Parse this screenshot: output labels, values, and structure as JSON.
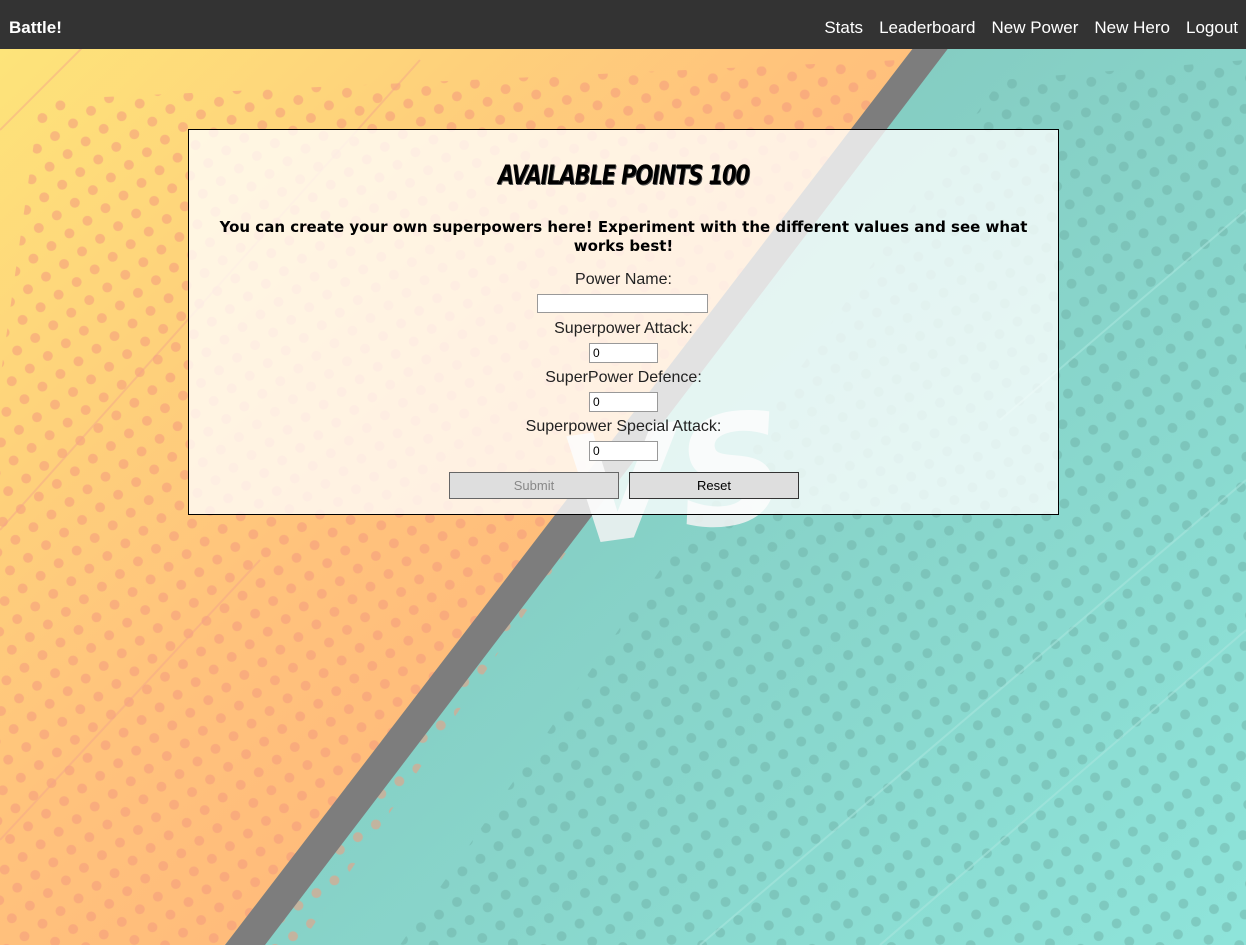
{
  "navbar": {
    "brand": "Battle!",
    "links": [
      "Stats",
      "Leaderboard",
      "New Power",
      "New Hero",
      "Logout"
    ]
  },
  "form": {
    "title": "Available Points 100",
    "intro": "You can create your own superpowers here! Experiment with the different values and see what works best!",
    "power_name_label": "Power Name:",
    "power_name_value": "",
    "attack_label": "Superpower Attack:",
    "attack_value": "0",
    "defence_label": "SuperPower Defence:",
    "defence_value": "0",
    "special_label": "Superpower Special Attack:",
    "special_value": "0",
    "submit_label": "Submit",
    "reset_label": "Reset"
  },
  "background": {
    "emblem_text": "VS"
  },
  "colors": {
    "navbar": "#333333",
    "bg_yellow": "#fde67a",
    "bg_orange": "#ffbb7a",
    "bg_teal": "#8fd8cf",
    "stripe": "#7d7d7d"
  }
}
